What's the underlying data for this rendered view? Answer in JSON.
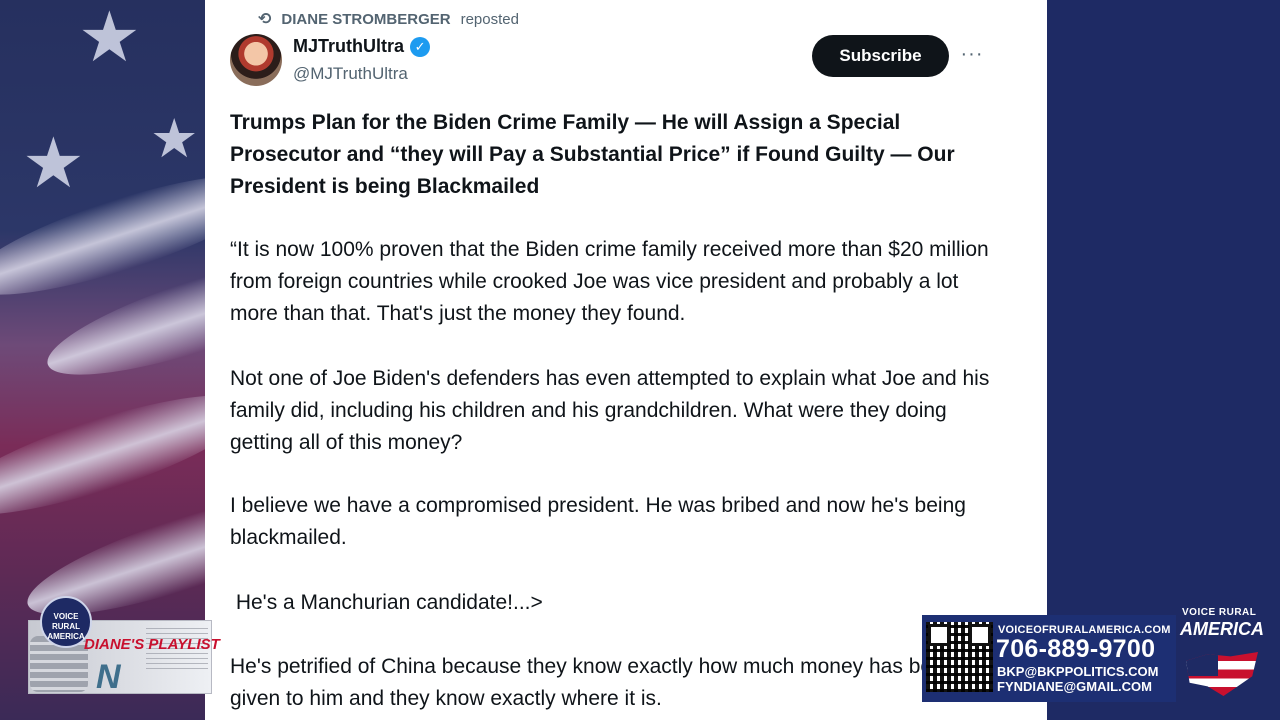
{
  "repost": {
    "user": "DIANE STROMBERGER",
    "suffix": "reposted"
  },
  "author": {
    "name": "MJTruthUltra",
    "handle": "@MJTruthUltra"
  },
  "actions": {
    "subscribe_label": "Subscribe",
    "more_label": "···"
  },
  "post": {
    "headline": "Trumps Plan for the Biden Crime Family — He will Assign a Special Prosecutor  and “they will Pay a Substantial Price” if Found Guilty — Our President is being Blackmailed",
    "paragraphs": [
      "“It is now 100% proven that the Biden crime family received more than $20 million from foreign countries while crooked Joe was vice president and probably a lot more than that. That's just the money they found.",
      "Not one of Joe Biden's defenders has even attempted to explain what Joe and his family did, including his children and his grandchildren. What were they doing getting all of this money?",
      "I believe we have a compromised president. He was bribed and now he's being blackmailed.",
      " He's a Manchurian candidate!...>",
      "He's petrified of China because they know exactly how much money has been given to him and they know exactly where it is."
    ]
  },
  "overlay": {
    "playlist": {
      "badge": "VOICE RURAL AMERICA",
      "title": "DIANE'S PLAYLIST",
      "mark": "N"
    },
    "contact": {
      "website": "VOICEOFRURALAMERICA.COM",
      "phone": "706-889-9700",
      "email1": "BKP@BKPPOLITICS.COM",
      "email2": "FYNDIANE@GMAIL.COM"
    },
    "logo": {
      "line1": "VOICE RURAL",
      "line2": "AMERICA"
    }
  },
  "colors": {
    "accent": "#1d9bf0",
    "card_bg": "#ffffff",
    "brand_blue": "#1e2a64",
    "brand_red": "#c8102e"
  }
}
